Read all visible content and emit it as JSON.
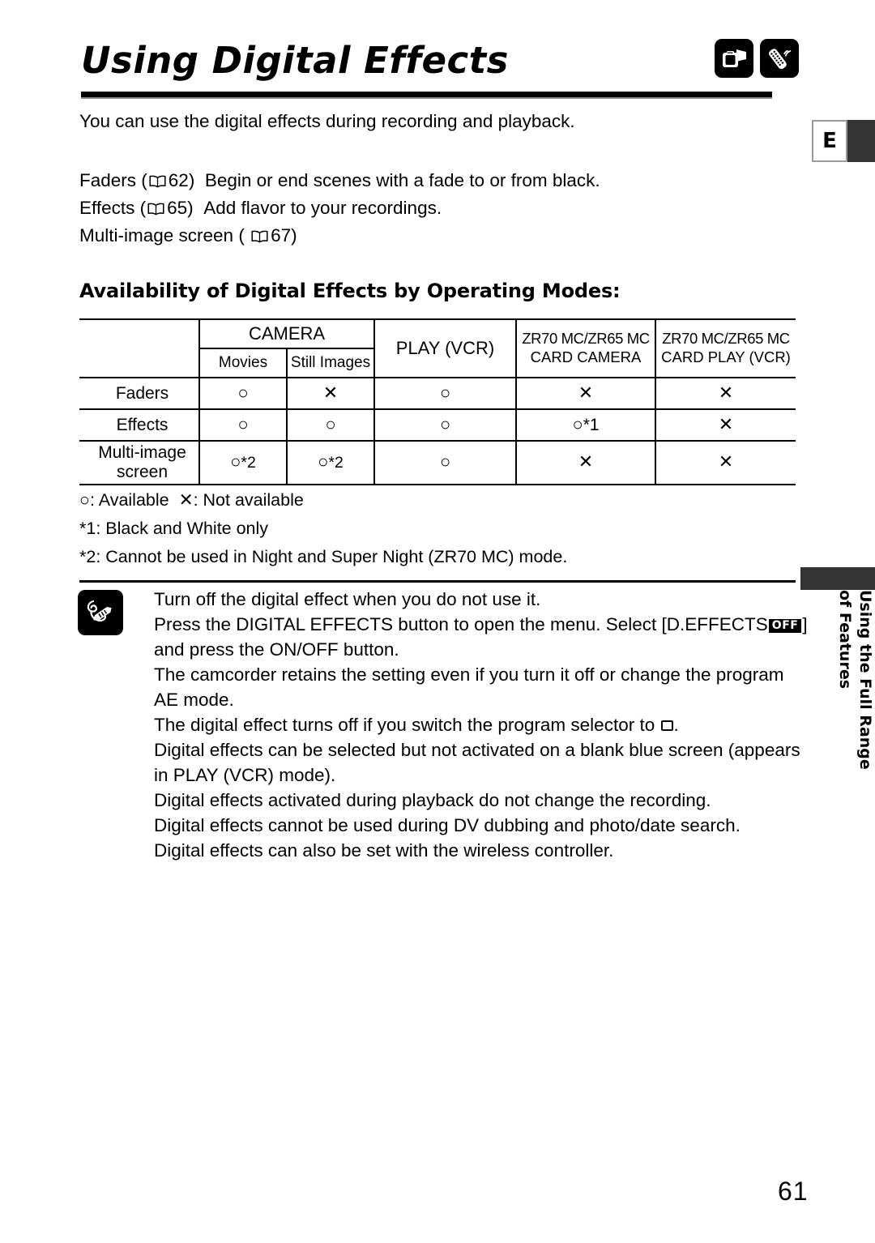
{
  "header": {
    "title": "Using Digital Effects",
    "icons": [
      "camcorder-icon",
      "remote-control-icon"
    ]
  },
  "lang_tab": {
    "label": "E"
  },
  "intro": {
    "text": "You can use the digital effects during recording and playback."
  },
  "features": [
    {
      "name": "Faders",
      "open_paren": "(",
      "page_ref": "62",
      "close_paren": ")",
      "description": "Begin or end scenes with a fade to or from black."
    },
    {
      "name": "Effects",
      "open_paren": "(",
      "page_ref": "65",
      "close_paren": ")",
      "description": "Add flavor to your recordings."
    },
    {
      "name": "Multi-image screen",
      "open_paren": "(",
      "page_ref": "67",
      "close_paren": ")",
      "description": ""
    }
  ],
  "section": {
    "heading": "Availability of Digital Effects by Operating Modes:"
  },
  "table": {
    "header": {
      "camera": "CAMERA",
      "movies": "Movies",
      "still_images": "Still Images",
      "play_vcr": "PLAY (VCR)",
      "card_camera_line1": "ZR70 MC/ZR65 MC",
      "card_camera_line2": "CARD CAMERA",
      "card_play_line1": "ZR70 MC/ZR65 MC",
      "card_play_line2": "CARD PLAY (VCR)"
    },
    "rows": [
      {
        "label": "Faders",
        "movies": "○",
        "movies_note": "",
        "still_images": "✕",
        "still_images_note": "",
        "play_vcr": "○",
        "play_vcr_note": "",
        "card_camera": "✕",
        "card_camera_note": "",
        "card_play": "✕",
        "card_play_note": ""
      },
      {
        "label": "Effects",
        "movies": "○",
        "movies_note": "",
        "still_images": "○",
        "still_images_note": "",
        "play_vcr": "○",
        "play_vcr_note": "",
        "card_camera": "○",
        "card_camera_note": "*1",
        "card_play": "✕",
        "card_play_note": ""
      },
      {
        "label": "Multi-image screen",
        "movies": "○",
        "movies_note": "*2",
        "still_images": "○",
        "still_images_note": "*2",
        "play_vcr": "○",
        "play_vcr_note": "",
        "card_camera": "✕",
        "card_camera_note": "",
        "card_play": "✕",
        "card_play_note": ""
      }
    ]
  },
  "legend": {
    "available": "○: Available",
    "not_available": "✕: Not available",
    "footnote1": "*1: Black and White only",
    "footnote2": "*2: Cannot be used in Night and Super Night (ZR70 MC) mode."
  },
  "notes": {
    "icon": "memo-pencil-icon",
    "items": [
      {
        "text": "Turn off the digital effect when you do not use it."
      },
      {
        "prefix": "Press the DIGITAL EFFECTS button to open the menu. Select [D.EFFECTS",
        "badge": "OFF",
        "suffix": "]",
        "continuation": "and press the ON/OFF button."
      },
      {
        "text": "The camcorder retains the setting even if you turn it off or change the program AE mode."
      },
      {
        "prefix": "The digital effect turns off if you switch the program selector to",
        "glyph": "program-selector-square-icon",
        "suffix": "."
      },
      {
        "text": "Digital effects can be selected but not activated on a blank blue screen (appears in PLAY (VCR) mode)."
      },
      {
        "text": "Digital effects activated during playback do not change the recording."
      },
      {
        "text": "Digital effects cannot be used during DV dubbing and photo/date search."
      },
      {
        "text": "Digital effects can also be set with the wireless controller."
      }
    ]
  },
  "side_tab": {
    "line1": "Using the Full Range",
    "line2": "of Features"
  },
  "page_number": "61"
}
